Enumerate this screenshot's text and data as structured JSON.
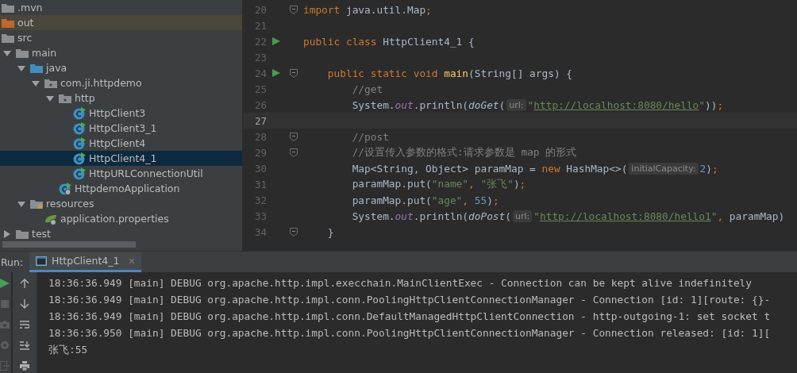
{
  "project_tree": [
    {
      "label": ".mvn",
      "kind": "folder"
    },
    {
      "label": "out",
      "kind": "excluded-folder"
    },
    {
      "label": "src",
      "kind": "folder",
      "children": [
        {
          "label": "main",
          "kind": "folder",
          "expanded": true,
          "children": [
            {
              "label": "java",
              "kind": "source-folder",
              "expanded": true,
              "children": [
                {
                  "label": "com.ji.httpdemo",
                  "kind": "package",
                  "expanded": true,
                  "children": [
                    {
                      "label": "http",
                      "kind": "package",
                      "expanded": true,
                      "children": [
                        {
                          "label": "HttpClient3",
                          "kind": "class",
                          "selected": false
                        },
                        {
                          "label": "HttpClient3_1",
                          "kind": "class",
                          "selected": false
                        },
                        {
                          "label": "HttpClient4",
                          "kind": "class",
                          "selected": false
                        },
                        {
                          "label": "HttpClient4_1",
                          "kind": "class",
                          "selected": true
                        },
                        {
                          "label": "HttpURLConnectionUtil",
                          "kind": "class",
                          "selected": false
                        }
                      ]
                    },
                    {
                      "label": "HttpdemoApplication",
                      "kind": "spring-class",
                      "selected": false
                    }
                  ]
                }
              ]
            },
            {
              "label": "resources",
              "kind": "resources-folder",
              "expanded": true,
              "children": [
                {
                  "label": "application.properties",
                  "kind": "properties",
                  "selected": false
                }
              ]
            }
          ]
        },
        {
          "label": "test",
          "kind": "folder",
          "expanded": false
        }
      ]
    }
  ],
  "editor": {
    "lines": [
      {
        "number": "20",
        "fold": true,
        "run": false,
        "current": false,
        "tokens": [
          {
            "kind": "keyword",
            "text": "import"
          },
          {
            "kind": "plain",
            "text": " java.util.Map"
          },
          {
            "kind": "keyword",
            "text": ";"
          }
        ]
      },
      {
        "number": "21",
        "fold": false,
        "run": false,
        "current": false
      },
      {
        "number": "22",
        "fold": false,
        "run": true,
        "current": false,
        "tokens": [
          {
            "kind": "keyword",
            "text": "public class "
          },
          {
            "kind": "plain",
            "text": "HttpClient4_1 {"
          }
        ]
      },
      {
        "number": "23",
        "fold": false,
        "run": false,
        "current": false
      },
      {
        "number": "24",
        "fold": true,
        "run": true,
        "current": false,
        "tokens": [
          {
            "kind": "keyword",
            "text": "    public static void "
          },
          {
            "kind": "method",
            "text": "main"
          },
          {
            "kind": "plain",
            "text": "(String[] args) {"
          }
        ]
      },
      {
        "number": "25",
        "fold": false,
        "run": false,
        "current": false,
        "tokens": [
          {
            "kind": "comment",
            "text": "        //get"
          }
        ]
      },
      {
        "number": "26",
        "fold": false,
        "run": false,
        "current": false,
        "tokens": [
          {
            "kind": "plain",
            "text": "        System."
          },
          {
            "kind": "field",
            "text": "out"
          },
          {
            "kind": "plain",
            "text": ".println("
          },
          {
            "kind": "call",
            "text": "doGet"
          },
          {
            "kind": "plain",
            "text": "("
          },
          {
            "kind": "hint",
            "text": "url:"
          },
          {
            "kind": "string",
            "text": "\""
          },
          {
            "kind": "url",
            "text": "http://localhost:8080/hello"
          },
          {
            "kind": "string",
            "text": "\""
          },
          {
            "kind": "plain",
            "text": "))"
          },
          {
            "kind": "keyword",
            "text": ";"
          }
        ]
      },
      {
        "number": "27",
        "fold": false,
        "run": false,
        "current": true
      },
      {
        "number": "28",
        "fold": true,
        "run": false,
        "current": false,
        "tokens": [
          {
            "kind": "comment",
            "text": "        //post"
          }
        ]
      },
      {
        "number": "29",
        "fold": true,
        "run": false,
        "current": false,
        "tokens": [
          {
            "kind": "comment",
            "text": "        //设置传入参数的格式:请求参数是 map 的形式"
          }
        ]
      },
      {
        "number": "30",
        "fold": false,
        "run": false,
        "current": false,
        "tokens": [
          {
            "kind": "plain",
            "text": "        Map<String, Object> paramMap = "
          },
          {
            "kind": "keyword",
            "text": "new "
          },
          {
            "kind": "plain",
            "text": "HashMap<>("
          },
          {
            "kind": "hint",
            "text": "initialCapacity:"
          },
          {
            "kind": "number",
            "text": "2"
          },
          {
            "kind": "plain",
            "text": ")"
          },
          {
            "kind": "keyword",
            "text": ";"
          }
        ]
      },
      {
        "number": "31",
        "fold": false,
        "run": false,
        "current": false,
        "tokens": [
          {
            "kind": "plain",
            "text": "        paramMap.put("
          },
          {
            "kind": "string",
            "text": "\"name\""
          },
          {
            "kind": "keyword",
            "text": ", "
          },
          {
            "kind": "string",
            "text": "\"张飞\""
          },
          {
            "kind": "plain",
            "text": ")"
          },
          {
            "kind": "keyword",
            "text": ";"
          }
        ]
      },
      {
        "number": "32",
        "fold": false,
        "run": false,
        "current": false,
        "tokens": [
          {
            "kind": "plain",
            "text": "        paramMap.put("
          },
          {
            "kind": "string",
            "text": "\"age\""
          },
          {
            "kind": "keyword",
            "text": ", "
          },
          {
            "kind": "number",
            "text": "55"
          },
          {
            "kind": "plain",
            "text": ")"
          },
          {
            "kind": "keyword",
            "text": ";"
          }
        ]
      },
      {
        "number": "33",
        "fold": false,
        "run": false,
        "current": false,
        "tokens": [
          {
            "kind": "plain",
            "text": "        System."
          },
          {
            "kind": "field",
            "text": "out"
          },
          {
            "kind": "plain",
            "text": ".println("
          },
          {
            "kind": "call",
            "text": "doPost"
          },
          {
            "kind": "plain",
            "text": "("
          },
          {
            "kind": "hint",
            "text": "url:"
          },
          {
            "kind": "string",
            "text": "\""
          },
          {
            "kind": "url",
            "text": "http://localhost:8080/hello1"
          },
          {
            "kind": "string",
            "text": "\""
          },
          {
            "kind": "keyword",
            "text": ", "
          },
          {
            "kind": "plain",
            "text": "paramMap)"
          }
        ]
      },
      {
        "number": "34",
        "fold": true,
        "run": false,
        "current": false,
        "tokens": [
          {
            "kind": "plain",
            "text": "    }"
          }
        ]
      }
    ]
  },
  "run_panel": {
    "label": "Run:",
    "tabs": [
      {
        "label": "HttpClient4_1",
        "selected": true
      }
    ],
    "console": [
      "18:36:36.949 [main] DEBUG org.apache.http.impl.execchain.MainClientExec - Connection can be kept alive indefinitely",
      "18:36:36.949 [main] DEBUG org.apache.http.impl.conn.PoolingHttpClientConnectionManager - Connection [id: 1][route: {}-",
      "18:36:36.949 [main] DEBUG org.apache.http.impl.conn.DefaultManagedHttpClientConnection - http-outgoing-1: set socket t",
      "18:36:36.950 [main] DEBUG org.apache.http.impl.conn.PoolingHttpClientConnectionManager - Connection released: [id: 1][",
      "张飞:55"
    ]
  }
}
